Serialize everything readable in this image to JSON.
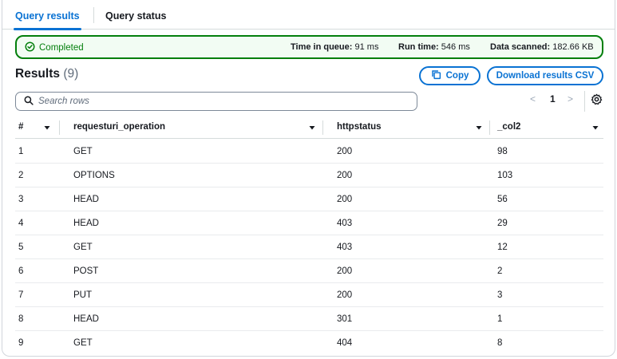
{
  "tabs": [
    {
      "label": "Query results",
      "active": true
    },
    {
      "label": "Query status",
      "active": false
    }
  ],
  "status": {
    "label": "Completed",
    "time_in_queue_label": "Time in queue:",
    "time_in_queue_value": "91 ms",
    "run_time_label": "Run time:",
    "run_time_value": "546 ms",
    "data_scanned_label": "Data scanned:",
    "data_scanned_value": "182.66 KB",
    "color": "#037f0c"
  },
  "results": {
    "title": "Results",
    "count": "(9)"
  },
  "buttons": {
    "copy": "Copy",
    "download": "Download results CSV"
  },
  "search": {
    "placeholder": "Search rows",
    "value": ""
  },
  "pagination": {
    "prev": "<",
    "page": "1",
    "next": ">"
  },
  "table": {
    "columns": [
      "#",
      "requesturi_operation",
      "httpstatus",
      "_col2"
    ],
    "rows": [
      [
        "1",
        "GET",
        "200",
        "98"
      ],
      [
        "2",
        "OPTIONS",
        "200",
        "103"
      ],
      [
        "3",
        "HEAD",
        "200",
        "56"
      ],
      [
        "4",
        "HEAD",
        "403",
        "29"
      ],
      [
        "5",
        "GET",
        "403",
        "12"
      ],
      [
        "6",
        "POST",
        "200",
        "2"
      ],
      [
        "7",
        "PUT",
        "200",
        "3"
      ],
      [
        "8",
        "HEAD",
        "301",
        "1"
      ],
      [
        "9",
        "GET",
        "404",
        "8"
      ]
    ]
  },
  "colors": {
    "accent": "#0972d3",
    "success": "#037f0c",
    "success_bg": "#f2fcf3"
  }
}
